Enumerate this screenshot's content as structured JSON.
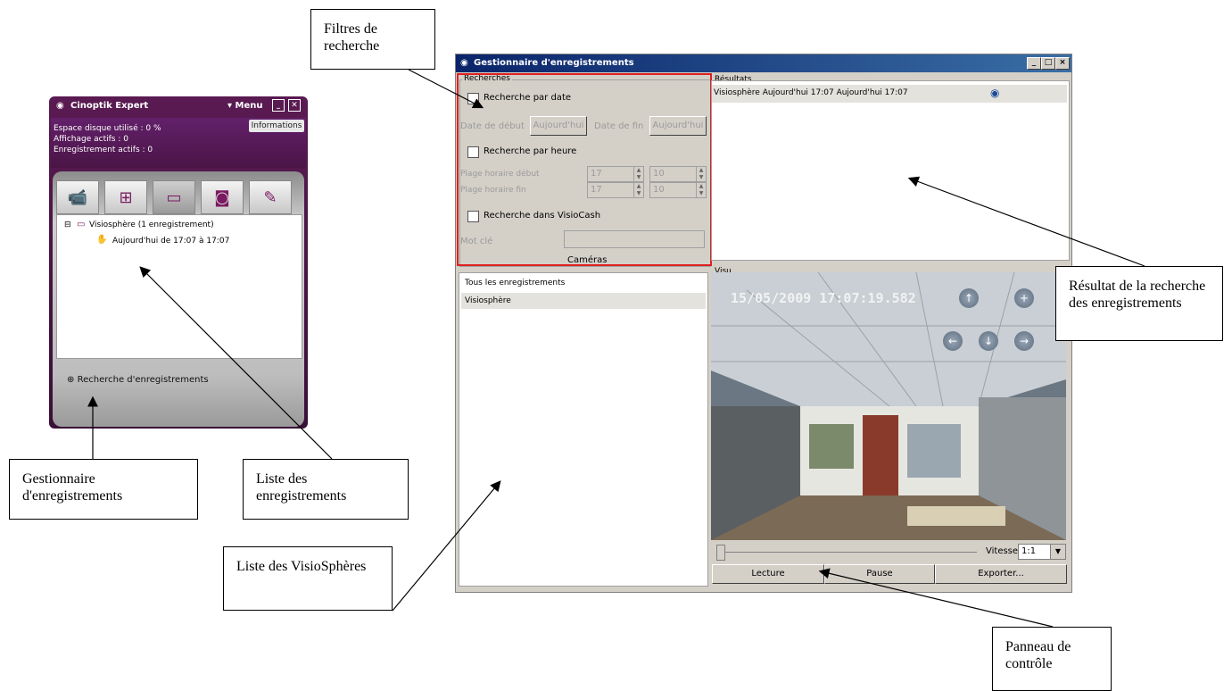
{
  "cinoptik": {
    "title": "Cinoptik Expert",
    "menu": "▾ Menu",
    "info_tab": "Informations",
    "info_lines": [
      "Espace disque utilisé : 0 %",
      "Affichage actifs : 0",
      "Enregistrement actifs : 0"
    ],
    "tree_root": "Visiosphère (1 enregistrement)",
    "tree_child": "Aujourd'hui de 17:07 à 17:07",
    "search_link": "Recherche d'enregistrements"
  },
  "window": {
    "title": "Gestionnaire d'enregistrements",
    "controls": [
      "_",
      "□",
      "×"
    ]
  },
  "recherches": {
    "legend": "Recherches",
    "by_date": "Recherche par date",
    "start_date_label": "Date de début",
    "start_date_btn": "Aujourd'hui",
    "end_date_label": "Date de fin",
    "end_date_btn": "Aujourd'hui",
    "by_hour": "Recherche par heure",
    "start_range_label": "Plage horaire début",
    "end_range_label": "Plage horaire fin",
    "start_h": "17",
    "start_m": "10",
    "end_h": "17",
    "end_m": "10",
    "visiocash": "Recherche dans VisioCash",
    "keyword_label": "Mot clé",
    "cameras_label": "Caméras"
  },
  "results": {
    "legend": "Résultats",
    "row": "Visiosphère  Aujourd'hui 17:07  Aujourd'hui 17:07"
  },
  "cameras": [
    "Tous les enregistrements",
    "Visiosphère"
  ],
  "visu": {
    "legend": "Visu",
    "timestamp": "15/05/2009 17:07:19.582"
  },
  "controls": {
    "speed_label": "Vitesse :",
    "speed_value": "1:1",
    "play": "Lecture",
    "pause": "Pause",
    "export": "Exporter..."
  },
  "callouts": {
    "filtres": "Filtres de recherche",
    "resultat": "Résultat de la recherche des enregistrements",
    "gestionnaire": "Gestionnaire d'enregistrements",
    "liste_enr": "Liste des enregistrements",
    "liste_visio": "Liste des VisioSphères",
    "panneau": "Panneau de contrôle"
  }
}
